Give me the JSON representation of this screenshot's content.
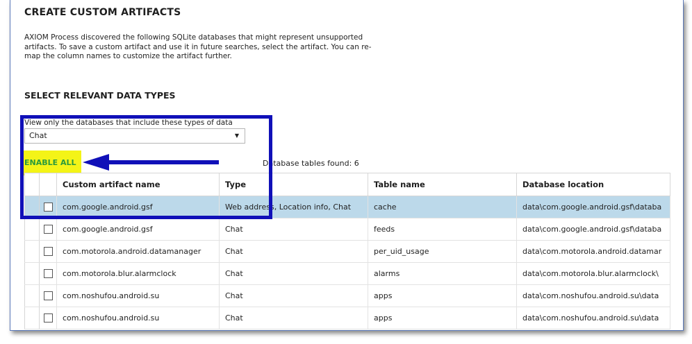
{
  "header": {
    "title": "CREATE CUSTOM ARTIFACTS",
    "description": "AXIOM Process discovered the following SQLite databases that might represent unsupported artifacts. To save a custom artifact and use it in future searches, select the artifact. You can re-map the column names to customize the artifact further."
  },
  "data_types": {
    "title": "SELECT RELEVANT DATA TYPES",
    "filter_label": "View only the databases that include these types of data",
    "filter_value": "Chat"
  },
  "actions": {
    "enable_all": "ENABLE ALL",
    "tables_found": "Database tables found: 6"
  },
  "table": {
    "columns": [
      "Custom artifact name",
      "Type",
      "Table name",
      "Database location"
    ],
    "rows": [
      {
        "name": "com.google.android.gsf",
        "type": "Web address, Location info, Chat",
        "table": "cache",
        "location": "data\\com.google.android.gsf\\databa",
        "selected": true
      },
      {
        "name": "com.google.android.gsf",
        "type": "Chat",
        "table": "feeds",
        "location": "data\\com.google.android.gsf\\databa",
        "selected": false
      },
      {
        "name": "com.motorola.android.datamanager",
        "type": "Chat",
        "table": "per_uid_usage",
        "location": "data\\com.motorola.android.datamar",
        "selected": false
      },
      {
        "name": "com.motorola.blur.alarmclock",
        "type": "Chat",
        "table": "alarms",
        "location": "data\\com.motorola.blur.alarmclock\\",
        "selected": false
      },
      {
        "name": "com.noshufou.android.su",
        "type": "Chat",
        "table": "apps",
        "location": "data\\com.noshufou.android.su\\data",
        "selected": false
      },
      {
        "name": "com.noshufou.android.su",
        "type": "Chat",
        "table": "apps",
        "location": "data\\com.noshufou.android.su\\data",
        "selected": false
      }
    ]
  },
  "colors": {
    "highlight_border": "#1010b8",
    "enable_all_bg": "#f4f417",
    "enable_all_text": "#2b9a3c",
    "selected_row": "#bcd9ea"
  }
}
